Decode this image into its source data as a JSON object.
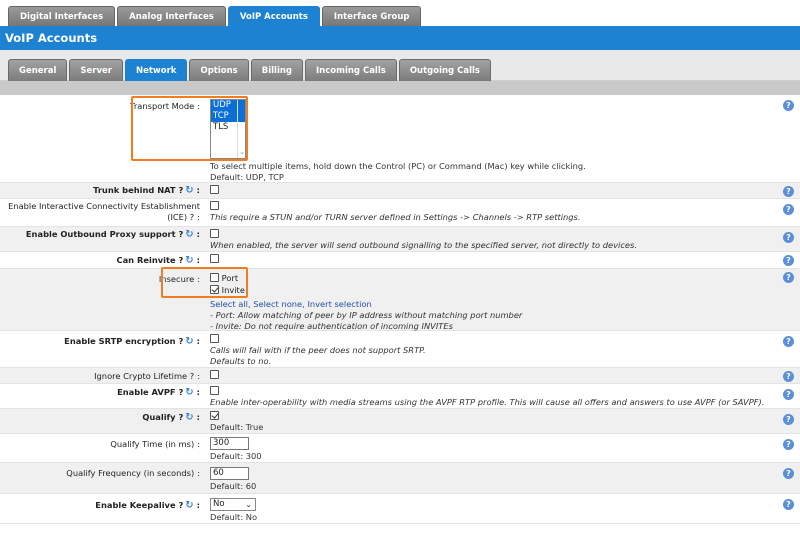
{
  "top_tabs": [
    "Digital Interfaces",
    "Analog Interfaces",
    "VoIP Accounts",
    "Interface Group"
  ],
  "title": "VoIP Accounts",
  "sub_tabs": [
    "General",
    "Server",
    "Network",
    "Options",
    "Billing",
    "Incoming Calls",
    "Outgoing Calls"
  ],
  "transport": {
    "label": "Transport Mode",
    "options": [
      "UDP",
      "TCP",
      "TLS"
    ],
    "selected": [
      "UDP",
      "TCP"
    ],
    "hint": "To select multiple items, hold down the Control (PC) or Command (Mac) key while clicking.",
    "default": "Default: UDP, TCP"
  },
  "nat": {
    "label": "Trunk behind NAT ?"
  },
  "ice": {
    "label": "Enable Interactive Connectivity Establishment (ICE) ?",
    "hint": "This require a STUN and/or TURN server defined in Settings -> Channels -> RTP settings."
  },
  "proxy": {
    "label": "Enable Outbound Proxy support ?",
    "hint": "When enabled, the server will send outbound signalling to the specified server, not directly to devices."
  },
  "reinvite": {
    "label": "Can Reinvite ?"
  },
  "insecure": {
    "label": "Insecure",
    "opt_port": "Port",
    "opt_invite": "Invite",
    "select_all": "Select all",
    "select_none": "Select none",
    "invert": "Invert selection",
    "hint1": "- Port: Allow matching of peer by IP address without matching port number",
    "hint2": "- Invite: Do not require authentication of incoming INVITEs"
  },
  "srtp": {
    "label": "Enable SRTP encryption ?",
    "hint1": "Calls will fail with if the peer does not support SRTP.",
    "hint2": "Defaults to no."
  },
  "crypto": {
    "label": "Ignore Crypto Lifetime ?"
  },
  "avpf": {
    "label": "Enable AVPF ?",
    "hint": "Enable inter-operability with media streams using the AVPF RTP profile. This will cause all offers and answers to use AVPF (or SAVPF)."
  },
  "qualify": {
    "label": "Qualify ?",
    "default": "Default: True"
  },
  "qualify_time": {
    "label": "Qualify Time (in ms)",
    "value": "300",
    "default": "Default: 300"
  },
  "qualify_freq": {
    "label": "Qualify Frequency (in seconds)",
    "value": "60",
    "default": "Default: 60"
  },
  "keepalive": {
    "label": "Enable Keepalive ?",
    "value": "No",
    "default": "Default: No"
  },
  "colors": {
    "accent": "#1e82d2",
    "highlight": "#f07d24",
    "help": "#5b8fd6"
  }
}
